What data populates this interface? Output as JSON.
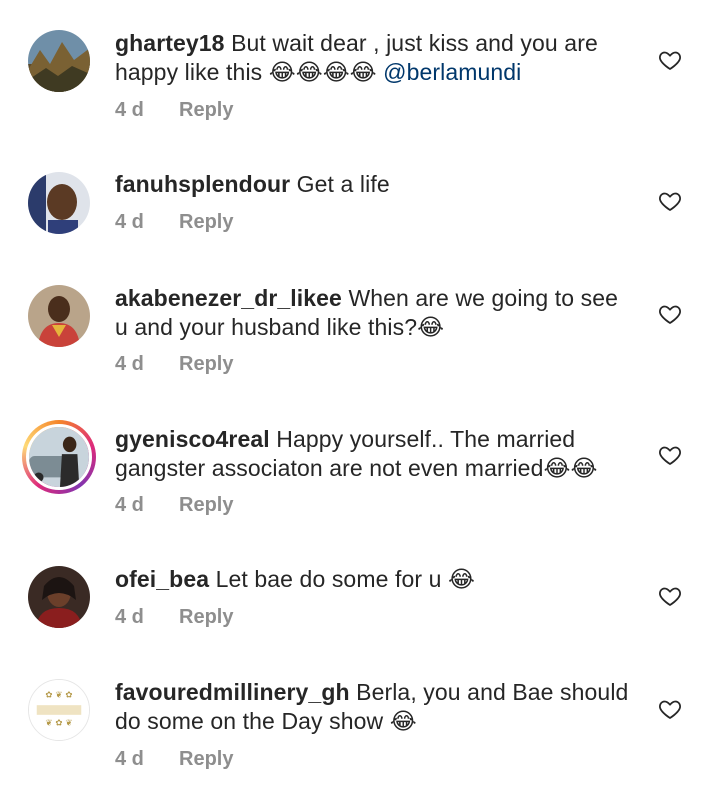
{
  "comments": [
    {
      "username": "ghartey18",
      "text": "But wait dear , just kiss and you are happy like this",
      "emojis": "😂😂😂😂",
      "mention": "@berlamundi",
      "age": "4 d",
      "reply_label": "Reply",
      "avatar": "landscape-photo"
    },
    {
      "username": "fanuhsplendour",
      "text": "Get a life",
      "emojis": "",
      "mention": "",
      "age": "4 d",
      "reply_label": "Reply",
      "avatar": "man-portrait"
    },
    {
      "username": "akabenezer_dr_likee",
      "text": "When are we going to see u and your husband like this?",
      "emojis": "😂",
      "mention": "",
      "age": "4 d",
      "reply_label": "Reply",
      "avatar": "man-portrait"
    },
    {
      "username": "gyenisco4real",
      "text": "Happy yourself.. The married gangster associaton are not even married",
      "emojis": "😂😂",
      "mention": "",
      "age": "4 d",
      "reply_label": "Reply",
      "avatar": "man-with-car",
      "has_story": true
    },
    {
      "username": "ofei_bea",
      "text": "Let bae do some for u",
      "emojis": "😂",
      "mention": "",
      "age": "4 d",
      "reply_label": "Reply",
      "avatar": "woman-portrait"
    },
    {
      "username": "favouredmillinery_gh",
      "text": "Berla, you and Bae should  do some on the Day show",
      "emojis": "😂",
      "mention": "",
      "age": "4 d",
      "reply_label": "Reply",
      "avatar": "favouredmillinery-logo",
      "avatar_text": "favouredmillinery_gh"
    }
  ],
  "colors": {
    "text": "#262626",
    "meta": "#8e8e8e",
    "mention": "#00376b"
  },
  "icons": {
    "like": "heart-outline-icon"
  }
}
